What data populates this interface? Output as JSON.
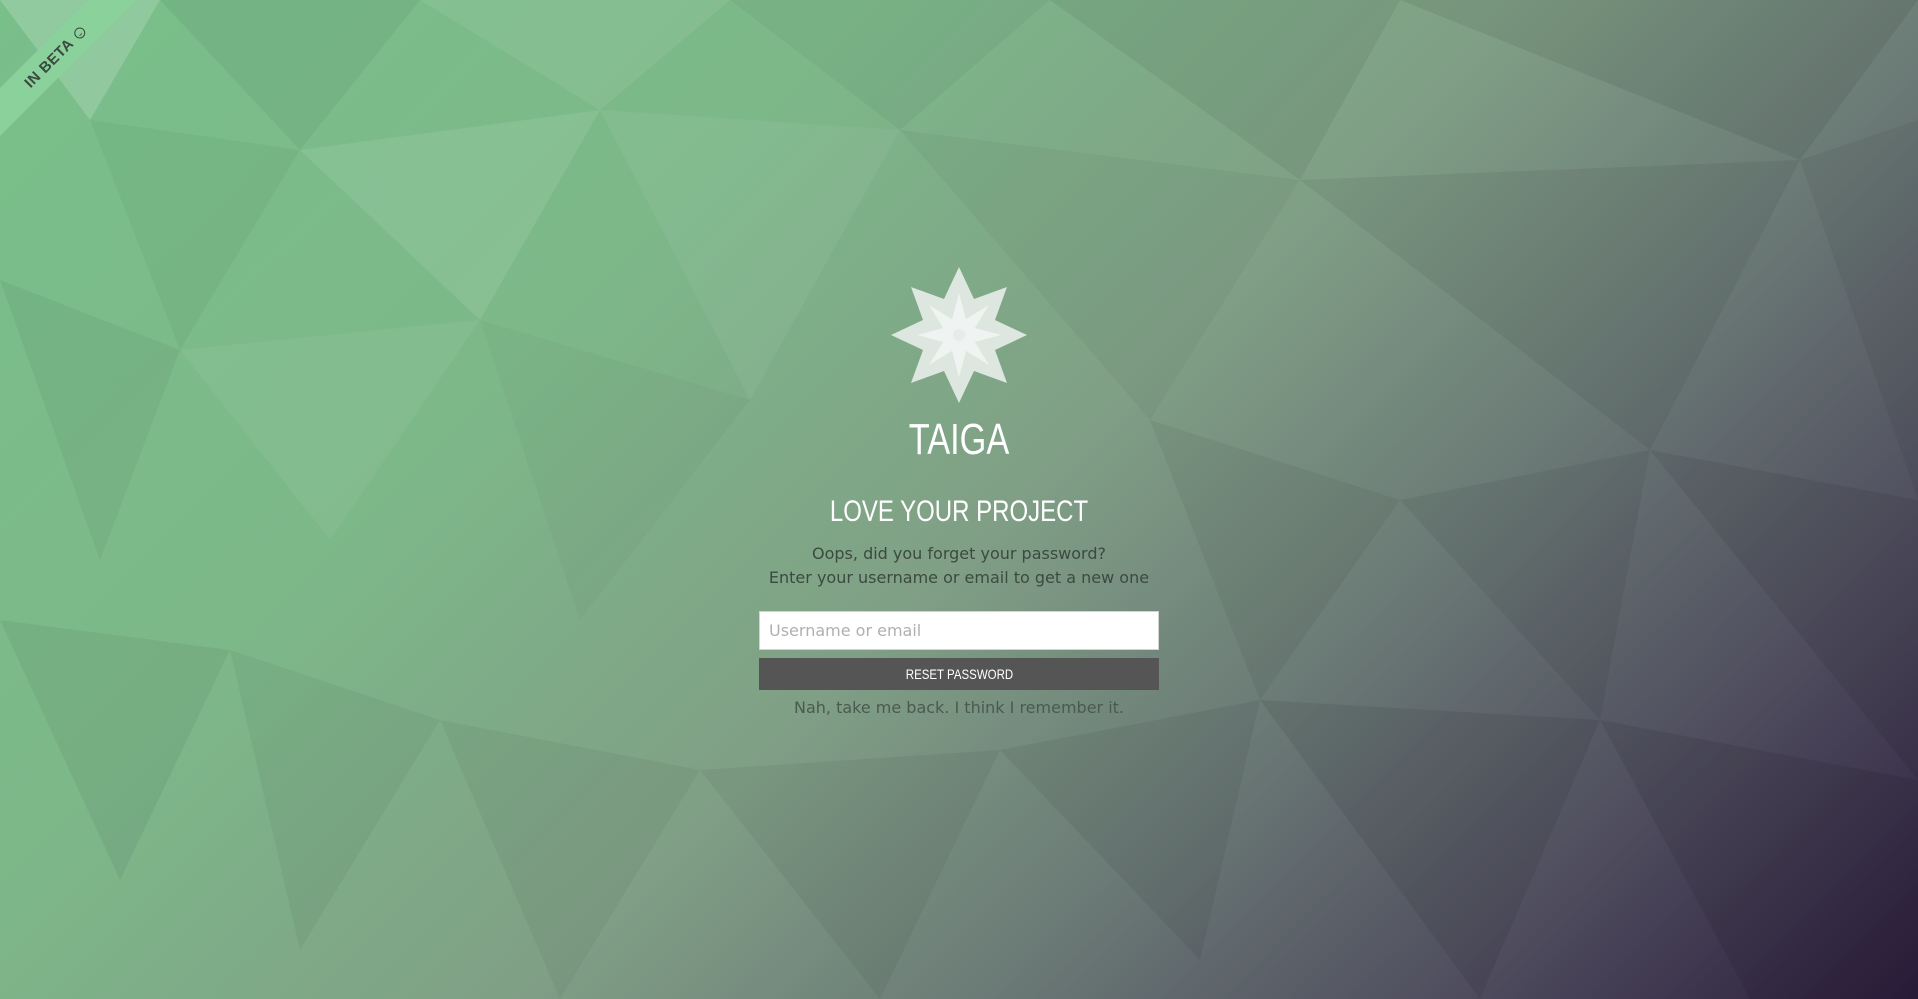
{
  "beta_badge": {
    "label": "IN BETA",
    "icon": "smiley-icon"
  },
  "brand": {
    "logo_icon": "taiga-logo-icon",
    "name": "TAIGA",
    "tagline": "LOVE YOUR PROJECT"
  },
  "reset_form": {
    "message_line1": "Oops, did you forget your password?",
    "message_line2": "Enter your username or email to get a new one",
    "input_value": "",
    "input_placeholder": "Username or email",
    "submit_label": "RESET PASSWORD",
    "back_link": "Nah, take me back. I think I remember it."
  },
  "colors": {
    "background_start": "#79bf8a",
    "background_end": "#2b1d3c",
    "button_bg": "#555555",
    "heading_text": "#ffffff"
  }
}
